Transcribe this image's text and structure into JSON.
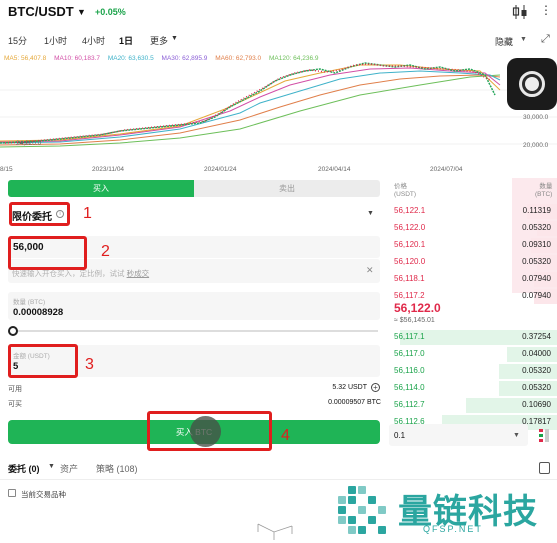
{
  "header": {
    "pair": "BTC/USDT",
    "change": "+0.05%",
    "colors": {
      "up": "#1aa34a",
      "down": "#e0294a",
      "accent": "#1fb456"
    }
  },
  "timeframes": {
    "tabs": [
      "15分",
      "1小时",
      "4小时",
      "1日",
      "更多"
    ],
    "active": "1日",
    "hide_label": "隐藏"
  },
  "ma_legend": [
    {
      "label": "MA5: 56,407.8",
      "color": "#e5a83a"
    },
    {
      "label": "MA10: 60,183.7",
      "color": "#d24fa6"
    },
    {
      "label": "MA20: 63,630.5",
      "color": "#3fb2c9"
    },
    {
      "label": "MA30: 62,895.9",
      "color": "#8b5fd6"
    },
    {
      "label": "MA60: 62,793.0",
      "color": "#e07f4a"
    },
    {
      "label": "MA120: 64,236.9",
      "color": "#6dbf5a"
    }
  ],
  "chart": {
    "x_labels": [
      "8/15",
      "2023/11/04",
      "2024/01/24",
      "2024/04/14",
      "2024/07/04"
    ],
    "y_labels": [
      "30,000.0",
      "20,000.0"
    ],
    "low_marker": "24,220.0"
  },
  "trade": {
    "buy_label": "买入",
    "sell_label": "卖出",
    "order_type": "限价委托",
    "price_value": "56,000",
    "hint_text": "快速输入开仓买入，定比例，试试",
    "hint_link": "秒成交",
    "qty_label": "数量 (BTC)",
    "qty_value": "0.00008928",
    "amount_label": "金额 (USDT)",
    "amount_value": "5",
    "available_label": "可用",
    "available_value": "5.32 USDT",
    "buyable_label": "可买",
    "buyable_value": "0.00009507 BTC",
    "submit_label": "买入 BTC",
    "slider_percent": 0
  },
  "orderbook": {
    "price_header": "价格",
    "price_unit": "(USDT)",
    "qty_header": "数量",
    "qty_unit": "(BTC)",
    "asks": [
      {
        "price": "56,122.1",
        "qty": "0.11319",
        "depth": 0.18
      },
      {
        "price": "56,122.0",
        "qty": "0.05320",
        "depth": 0.12
      },
      {
        "price": "56,120.1",
        "qty": "0.09310",
        "depth": 0.16
      },
      {
        "price": "56,120.0",
        "qty": "0.05320",
        "depth": 0.12
      },
      {
        "price": "56,118.1",
        "qty": "0.07940",
        "depth": 0.14
      },
      {
        "price": "56,117.2",
        "qty": "0.07940",
        "depth": 0.14
      }
    ],
    "last_price": "56,122.0",
    "last_usd": "≈ $56,145.01",
    "bids": [
      {
        "price": "56,117.1",
        "qty": "0.37254",
        "depth": 0.95
      },
      {
        "price": "56,117.0",
        "qty": "0.04000",
        "depth": 0.3
      },
      {
        "price": "56,116.0",
        "qty": "0.05320",
        "depth": 0.35
      },
      {
        "price": "56,114.0",
        "qty": "0.05320",
        "depth": 0.35
      },
      {
        "price": "56,112.7",
        "qty": "0.10690",
        "depth": 0.55
      },
      {
        "price": "56,112.6",
        "qty": "0.17817",
        "depth": 0.7
      }
    ],
    "depth_value": "0.1"
  },
  "bottom": {
    "tabs": [
      "委托 (0)",
      "资产",
      "策略 (108)"
    ],
    "current_pair_label": "当前交易品种"
  },
  "annotations": [
    "1",
    "2",
    "3",
    "4"
  ],
  "watermark": {
    "title": "量链科技",
    "subtitle": "QFSP.NET"
  }
}
